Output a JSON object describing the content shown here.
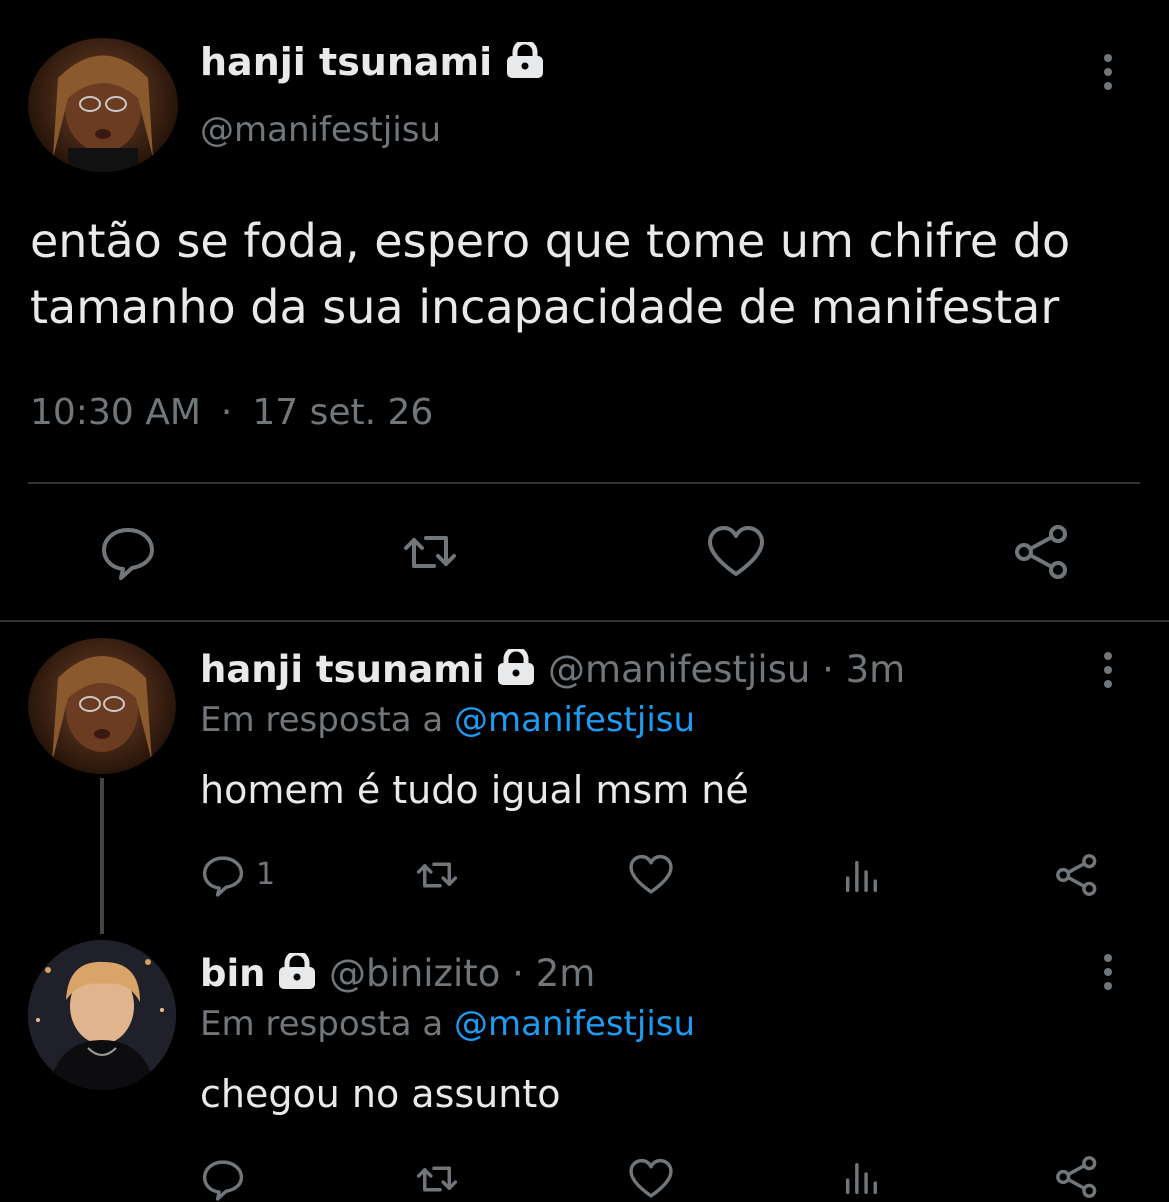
{
  "main_tweet": {
    "display_name": "hanji tsunami",
    "handle": "@manifestjisu",
    "text_line1": "então se foda, espero que tome um chifre do",
    "text_line2": "tamanho da sua incapacidade de manifestar",
    "time": "10:30 AM",
    "separator": "·",
    "date": "17 set. 26"
  },
  "replies": [
    {
      "display_name": "hanji tsunami",
      "handle": "@manifestjisu",
      "age": "3m",
      "reply_prefix": "Em resposta a",
      "reply_to": "@manifestjisu",
      "text": "homem é tudo igual msm né",
      "reply_count": "1"
    },
    {
      "display_name": "bin",
      "handle": "@binizito",
      "age": "2m",
      "reply_prefix": "Em resposta a",
      "reply_to": "@manifestjisu",
      "text": "chegou no assunto"
    }
  ],
  "icons": {
    "lock": "lock-icon",
    "more": "more-vertical-icon",
    "reply": "reply-icon",
    "retweet": "retweet-icon",
    "like": "heart-icon",
    "views": "views-icon",
    "share": "share-icon"
  },
  "colors": {
    "background": "#000000",
    "text": "#e7e9ea",
    "muted": "#71767b",
    "link": "#1d9bf0",
    "divider": "#2f3336"
  }
}
